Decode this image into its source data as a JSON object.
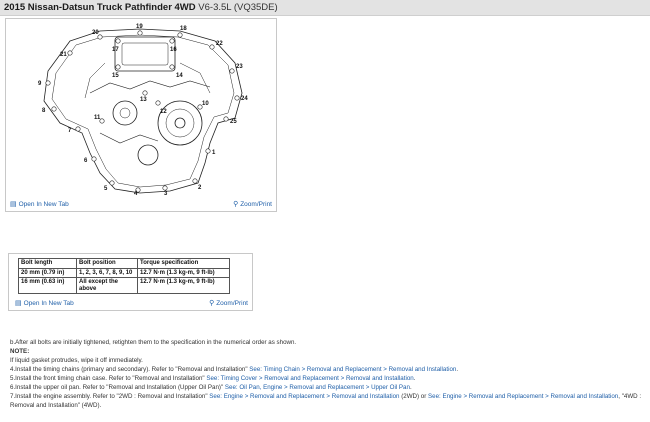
{
  "header": {
    "vehicle": "2015 Nissan-Datsun Truck Pathfinder 4WD",
    "engine": "V6-3.5L (VQ35DE)"
  },
  "figure": {
    "callouts": [
      "21",
      "20",
      "19",
      "18",
      "17",
      "16",
      "15",
      "14",
      "13",
      "12",
      "11",
      "10",
      "9",
      "8",
      "7",
      "6",
      "5",
      "4",
      "3",
      "2",
      "1",
      "22",
      "23",
      "24",
      "25"
    ],
    "open_label": "Open In New Tab",
    "zoom_label": "Zoom/Print"
  },
  "spec_table": {
    "headers": [
      "Bolt length",
      "Bolt position",
      "Torque specification"
    ],
    "rows": [
      {
        "length": "20 mm (0.79 in)",
        "position": "1, 2, 3, 6, 7, 8, 9, 10",
        "torque": "12.7 N·m (1.3 kg-m, 9 ft-lb)"
      },
      {
        "length": "16 mm (0.63 in)",
        "position": "All except the above",
        "torque": "12.7 N·m (1.3 kg-m, 9 ft-lb)"
      }
    ],
    "open_label": "Open In New Tab",
    "zoom_label": "Zoom/Print"
  },
  "notes": {
    "step_b": "b.After all bolts are initially tightened, retighten them to the specification in the numerical order as shown.",
    "note_heading": "NOTE:",
    "note_text": "If liquid gasket protrudes, wipe it off immediately.",
    "step4": {
      "text": "4.Install the timing chains (primary and secondary). Refer to \"Removal and Installation\" ",
      "see": "See: Timing Chain > Removal and Replacement > Removal and Installation",
      "end": "."
    },
    "step5": {
      "text": "5.Install the front timing chain case. Refer to \"Removal and Installation\" ",
      "see": "See: Timing Cover > Removal and Replacement > Removal and Installation",
      "end": "."
    },
    "step6": {
      "text": "6.Install the upper oil pan. Refer to \"Removal and Installation (Upper Oil Pan)\" ",
      "see": "See: Oil Pan, Engine > Removal and Replacement > Upper Oil Pan",
      "end": "."
    },
    "step7": {
      "text": "7.Install the engine assembly. Refer to \"2WD : Removal and Installation\" ",
      "see1": "See: Engine > Removal and Replacement > Removal and Installation",
      "mid": " (2WD) or ",
      "see2": "See: Engine > Removal and Replacement > Removal and Installation",
      "end": ", \"4WD : Removal and Installation\" (4WD)."
    }
  }
}
